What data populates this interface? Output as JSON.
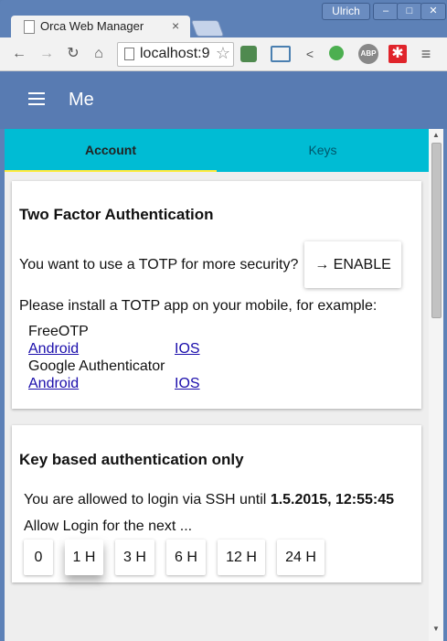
{
  "window": {
    "user": "Ulrich",
    "minimize_icon": "–",
    "maximize_icon": "□",
    "close_icon": "✕"
  },
  "browser": {
    "tab_title": "Orca Web Manager",
    "tab_close": "×",
    "url": "localhost:9",
    "back_glyph": "←",
    "forward_glyph": "→",
    "reload_glyph": "↻",
    "home_glyph": "⌂",
    "star_glyph": "☆",
    "ext_abp": "ABP",
    "menu_glyph": "≡"
  },
  "app": {
    "title": "Me"
  },
  "tabs": [
    {
      "label": "Account"
    },
    {
      "label": "Keys"
    }
  ],
  "two_factor": {
    "heading": "Two Factor Authentication",
    "question": "You want to use a TOTP for more security?",
    "enable_label": "→ ENABLE",
    "install_text": "Please install a TOTP app on your mobile, for example:",
    "apps": [
      {
        "name": "FreeOTP",
        "android": "Android",
        "ios": "IOS"
      },
      {
        "name": "Google Authenticator",
        "android": "Android",
        "ios": "IOS"
      }
    ]
  },
  "key_auth": {
    "heading": "Key based authentication only",
    "allowed_text": "You are allowed to login via SSH until",
    "allowed_until": "1.5.2015, 12:55:45",
    "allow_label": "Allow Login for the next ...",
    "durations": [
      "0",
      "1 H",
      "3 H",
      "6 H",
      "12 H",
      "24 H"
    ]
  },
  "colors": {
    "appbar": "#587bb2",
    "tabs": "#00bcd4",
    "ink": "#ffeb3b"
  }
}
